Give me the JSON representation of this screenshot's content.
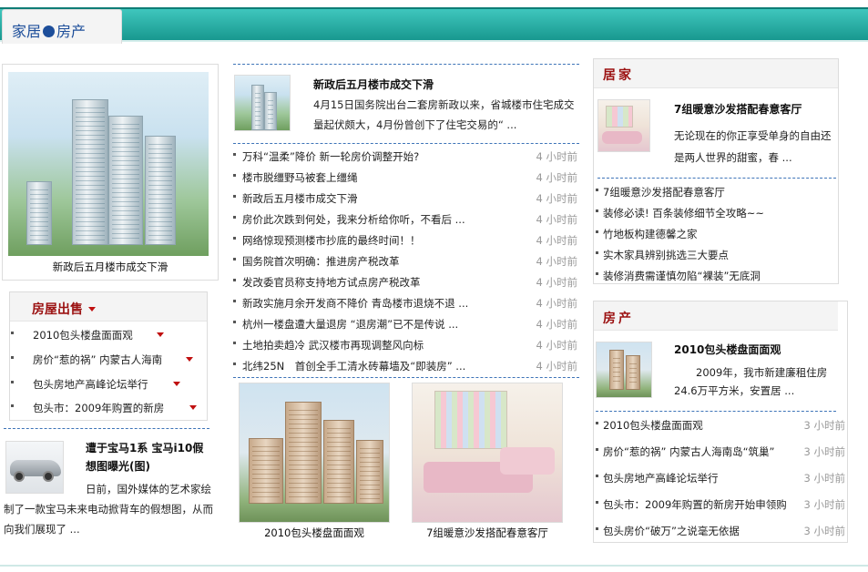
{
  "header": {
    "tab_part1": "家居",
    "tab_part2": "房产"
  },
  "left_feature": {
    "caption": "新政后五月楼市成交下滑"
  },
  "sale_box": {
    "title": "房屋出售",
    "items": [
      "2010包头楼盘面面观",
      "房价“惹的祸” 内蒙古人海南",
      "包头房地产高峰论坛举行",
      "包头市：2009年购置的新房"
    ]
  },
  "car_article": {
    "title": "遭于宝马1系 宝马i10假想图曝光(图)",
    "body": "日前，国外媒体的艺术家绘制了一款宝马未来电动掀背车的假想图，从而向我们展现了 ..."
  },
  "center_top": {
    "title": "新政后五月楼市成交下滑",
    "summary": "4月15日国务院出台二套房新政以来，省城楼市住宅成交量起伏颇大，4月份曾创下了住宅交易的“ ..."
  },
  "center_list": [
    {
      "text": "万科“温柔”降价 新一轮房价调整开始?",
      "time": "4 小时前"
    },
    {
      "text": "楼市脱缰野马被套上缰绳",
      "time": "4 小时前"
    },
    {
      "text": "新政后五月楼市成交下滑",
      "time": "4 小时前"
    },
    {
      "text": "房价此次跌到何处，我来分析给你听，不看后 ...",
      "time": "4 小时前"
    },
    {
      "text": "网络惊现预测楼市抄底的最终时间！！",
      "time": "4 小时前"
    },
    {
      "text": "国务院首次明确：推进房产税改革",
      "time": "4 小时前"
    },
    {
      "text": "发改委官员称支持地方试点房产税改革",
      "time": "4 小时前"
    },
    {
      "text": "新政实施月余开发商不降价 青岛楼市退烧不退 ...",
      "time": "4 小时前"
    },
    {
      "text": "杭州一楼盘遭大量退房 “退房潮”已不是传说 ...",
      "time": "4 小时前"
    },
    {
      "text": "土地拍卖趋冷 武汉楼市再现调整风向标",
      "time": "4 小时前"
    },
    {
      "text": "北纬25N　首创全手工清水砖幕墙及“即装房” ...",
      "time": "4 小时前"
    }
  ],
  "center_photos": [
    {
      "caption": "2010包头楼盘面面观"
    },
    {
      "caption": "7组暖意沙发搭配春意客厅"
    }
  ],
  "home_section": {
    "title": "居家",
    "feature_title": "7组暖意沙发搭配春意客厅",
    "feature_body": "无论现在的你正享受单身的自由还是两人世界的甜蜜，春 ...",
    "items": [
      "7组暖意沙发搭配春意客厅",
      "装修必读! 百条装修细节全攻略~~",
      "竹地板构建德馨之家",
      "实木家具辨别挑选三大要点",
      "装修消费需谨慎勿陷“裸装”无底洞"
    ]
  },
  "estate_section": {
    "title": "房产",
    "feature_title": "2010包头楼盘面面观",
    "feature_body": "2009年，我市新建廉租住房24.6万平方米，安置居 ...",
    "items": [
      {
        "text": "2010包头楼盘面面观",
        "time": "3 小时前"
      },
      {
        "text": "房价“惹的祸” 内蒙古人海南岛“筑巢”",
        "time": "3 小时前"
      },
      {
        "text": "包头房地产高峰论坛举行",
        "time": "3 小时前"
      },
      {
        "text": "包头市：2009年购置的新房开始申领购",
        "time": "3 小时前"
      },
      {
        "text": "包头房价“破万”之说毫无依据",
        "time": "3 小时前"
      }
    ]
  }
}
